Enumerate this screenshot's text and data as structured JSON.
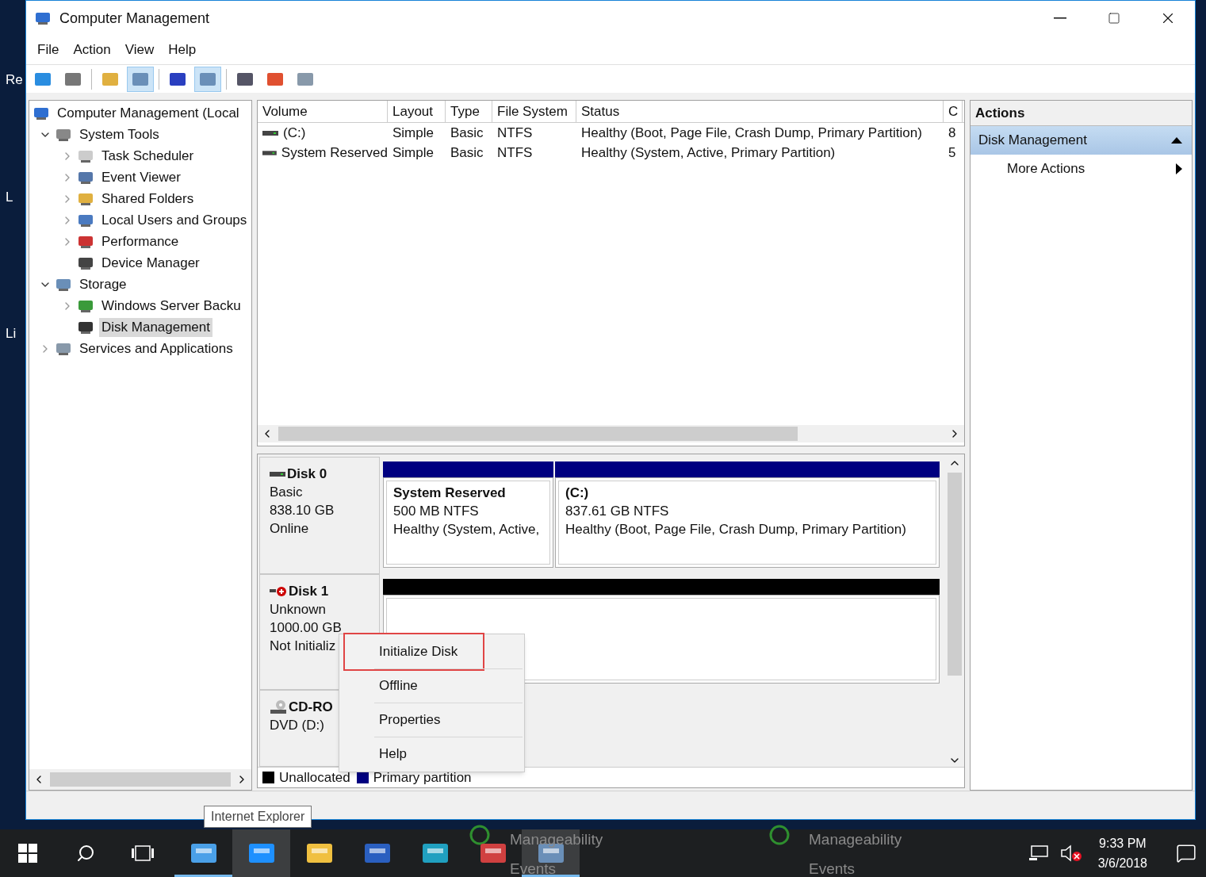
{
  "desktop": {
    "labels": [
      "Re",
      "L",
      "Li"
    ]
  },
  "window": {
    "title": "Computer Management"
  },
  "menu": [
    "File",
    "Action",
    "View",
    "Help"
  ],
  "toolbar": [
    {
      "pressed": false
    },
    {
      "pressed": false
    },
    {
      "pressed": false
    },
    {
      "pressed": true
    },
    {
      "pressed": false
    },
    {
      "pressed": true
    },
    {
      "pressed": false
    },
    {
      "pressed": false
    },
    {
      "pressed": false
    }
  ],
  "tree": [
    {
      "label": "Computer Management (Local",
      "selected": false,
      "children": [
        {
          "label": "System Tools",
          "expanded": true,
          "selected": false,
          "children": [
            {
              "label": "Task Scheduler",
              "expanded": false,
              "selected": false
            },
            {
              "label": "Event Viewer",
              "expanded": false,
              "selected": false
            },
            {
              "label": "Shared Folders",
              "expanded": false,
              "selected": false
            },
            {
              "label": "Local Users and Groups",
              "expanded": false,
              "selected": false
            },
            {
              "label": "Performance",
              "expanded": false,
              "selected": false
            },
            {
              "label": "Device Manager",
              "selected": false
            }
          ]
        },
        {
          "label": "Storage",
          "expanded": true,
          "selected": false,
          "children": [
            {
              "label": "Windows Server Backu",
              "expanded": false,
              "selected": false
            },
            {
              "label": "Disk Management",
              "selected": true
            }
          ]
        },
        {
          "label": "Services and Applications",
          "expanded": false,
          "selected": false
        }
      ]
    }
  ],
  "volume_list": {
    "columns": [
      "Volume",
      "Layout",
      "Type",
      "File System",
      "Status",
      "C"
    ],
    "rows": [
      {
        "cells": [
          "(C:)",
          "Simple",
          "Basic",
          "NTFS",
          "Healthy (Boot, Page File, Crash Dump, Primary Partition)",
          "8"
        ]
      },
      {
        "cells": [
          "System Reserved",
          "Simple",
          "Basic",
          "NTFS",
          "Healthy (System, Active, Primary Partition)",
          "5"
        ]
      }
    ]
  },
  "disks": [
    {
      "name": "Disk 0",
      "kind": "online",
      "lines": [
        "Basic",
        "838.10 GB",
        "Online"
      ],
      "partitions": [
        {
          "name": "System Reserved",
          "size": "500 MB NTFS",
          "status": "Healthy (System, Active,",
          "color": "#000080"
        },
        {
          "name": "(C:)",
          "size": "837.61 GB NTFS",
          "status": "Healthy (Boot, Page File, Crash Dump, Primary Partition)",
          "color": "#000080"
        }
      ]
    },
    {
      "name": "Disk 1",
      "kind": "not_initialized",
      "lines": [
        "Unknown",
        "1000.00 GB",
        "Not Initializ"
      ],
      "partitions": [
        {
          "color": "#000000"
        }
      ]
    },
    {
      "name": "CD-RO",
      "kind": "optical",
      "lines": [
        "DVD (D:)"
      ]
    }
  ],
  "legend": [
    {
      "label": "Unallocated",
      "color": "#000000"
    },
    {
      "label": "Primary partition",
      "color": "#000080"
    }
  ],
  "context_menu": {
    "items": [
      {
        "label": "Initialize Disk",
        "annotated": true
      },
      {
        "label": "Offline",
        "annotated": false
      },
      {
        "label": "Properties",
        "annotated": false
      },
      {
        "label": "Help",
        "annotated": false
      }
    ]
  },
  "actions": {
    "title": "Actions",
    "sections": [
      {
        "label": "Disk Management",
        "expanded": true,
        "items": [
          "More Actions"
        ]
      }
    ]
  },
  "tooltip": "Internet Explorer",
  "taskbar": {
    "apps": [
      {
        "running": true,
        "highlighted": false
      },
      {
        "running": false,
        "highlighted": true
      },
      {
        "running": false,
        "highlighted": false
      },
      {
        "running": false,
        "highlighted": false
      },
      {
        "running": false,
        "highlighted": false
      },
      {
        "running": false,
        "highlighted": false
      },
      {
        "running": true,
        "highlighted": true
      }
    ],
    "behind_texts": [
      "Manageability",
      "Events",
      "Manageability",
      "Events"
    ],
    "time": "9:33 PM",
    "date": "3/6/2018"
  }
}
